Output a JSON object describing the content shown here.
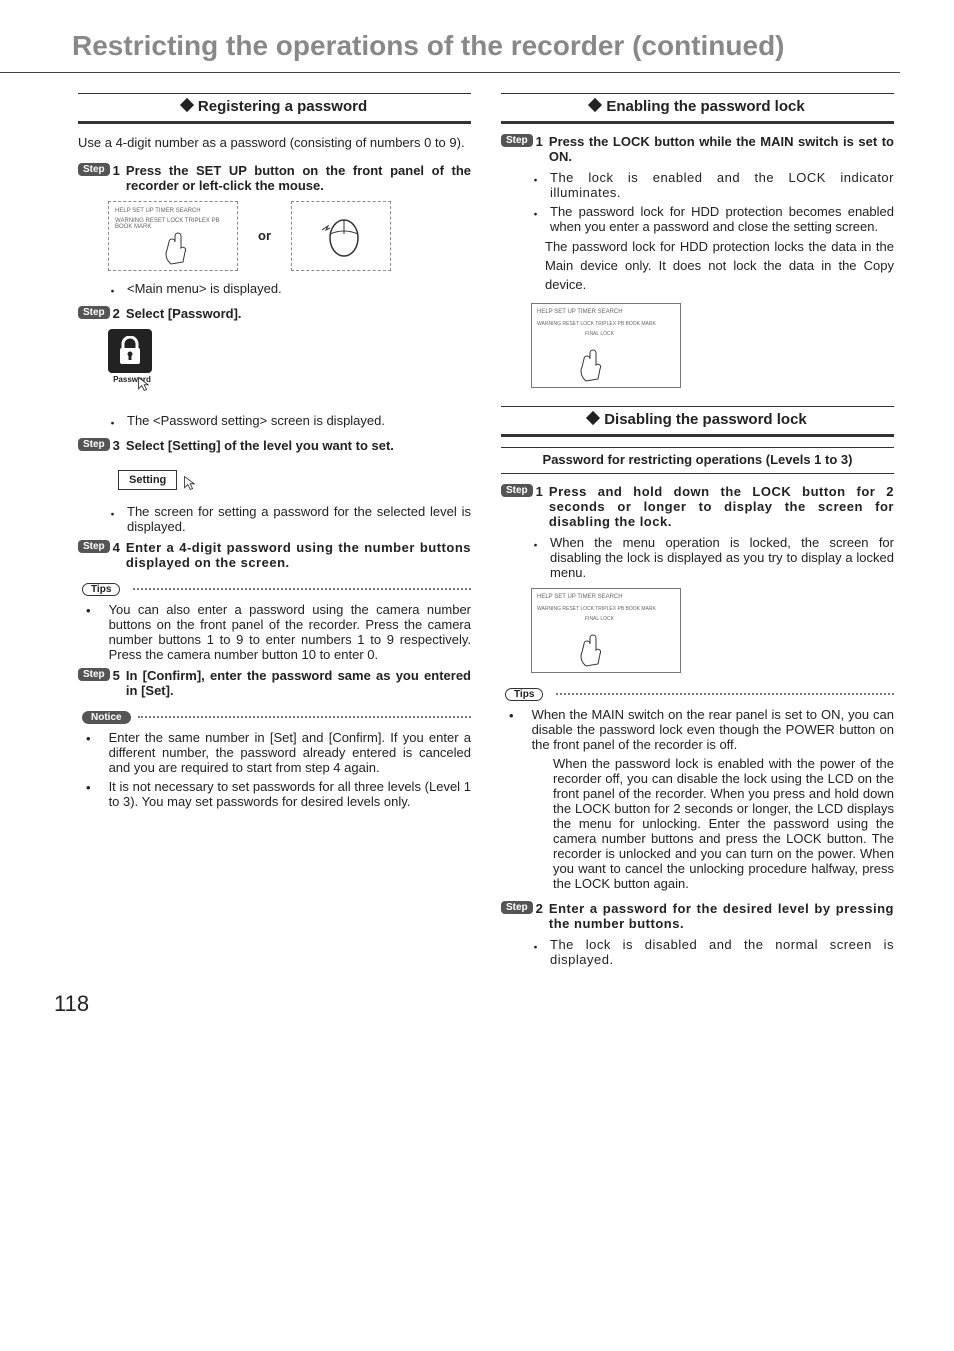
{
  "pageTitle": "Restricting the operations of the recorder (continued)",
  "pageNumber": "118",
  "labels": {
    "step": "Step",
    "tips": "Tips",
    "notice": "Notice",
    "or": "or"
  },
  "left": {
    "header": "Registering a password",
    "intro": "Use a 4-digit number as a password (consisting of numbers 0 to 9).",
    "step1": {
      "num": "1",
      "text": "Press the SET UP button on the front panel of the recorder or left-click the mouse."
    },
    "mainMenuNote": "<Main menu> is displayed.",
    "step2": {
      "num": "2",
      "text": "Select [Password]."
    },
    "passwordIconCaption": "Password",
    "pwSettingNote": "The <Password setting> screen is displayed.",
    "step3": {
      "num": "3",
      "text": "Select [Setting] of the level you want to set."
    },
    "settingBtn": "Setting",
    "levelNote": "The screen for setting a password for the selected level is displayed.",
    "step4": {
      "num": "4",
      "text": "Enter a 4-digit password using the number buttons displayed on the screen."
    },
    "tipsBody": "You can also enter a password using the camera number buttons on the front panel of the recorder. Press the camera number buttons 1 to 9 to enter numbers 1 to 9 respectively. Press the camera number button 10 to enter 0.",
    "step5": {
      "num": "5",
      "text": "In [Confirm], enter the password same as you entered in [Set]."
    },
    "notice1": "Enter the same number in [Set] and [Confirm]. If you enter a different number, the password already entered is canceled and you are required to start from step 4 again.",
    "notice2": "It is not necessary to set passwords for all three levels (Level 1 to 3). You may set passwords for desired levels only."
  },
  "right": {
    "enableHeader": "Enabling the password lock",
    "enableStep1": {
      "num": "1",
      "text": "Press the LOCK button while the MAIN switch is set to ON."
    },
    "enableNote1": "The lock is enabled and the LOCK indicator illuminates.",
    "enableNote2": "The password lock for HDD protection becomes enabled when you enter a password and close the setting screen.",
    "enableNote3": "The password lock for HDD protection locks the data in the Main device only. It does not lock the data in the Copy device.",
    "disableHeader": "Disabling the password lock",
    "subHeader": "Password for restricting operations (Levels 1 to 3)",
    "disableStep1": {
      "num": "1",
      "text": "Press and hold down the LOCK button for 2 seconds or longer to display the screen for disabling the lock."
    },
    "disableNote1": "When the menu operation is locked, the screen for disabling the lock is displayed as you try to display a locked menu.",
    "tips1": "When the MAIN switch on the rear panel is set to ON, you can disable the password lock even though the POWER button on the front panel of the recorder is off.",
    "tips2": "When the password lock is enabled with the power of the recorder off, you can disable the lock using the LCD on the front panel of the recorder. When you press and hold down the LOCK button for 2 seconds or longer, the LCD displays the menu for unlocking. Enter the password using the camera number buttons and press the LOCK button. The recorder is unlocked and you can turn on the power. When you want to cancel the unlocking procedure halfway, press the LOCK button again.",
    "disableStep2": {
      "num": "2",
      "text": "Enter a password for the desired level by pressing the number buttons."
    },
    "disableNote2": "The lock is disabled and the normal screen is displayed."
  },
  "panelLabels": {
    "top": "HELP  SET UP  TIMER  SEARCH",
    "mid": "WARNING RESET  LOCK  TRIPLEX PB  BOOK MARK",
    "f": "FINAL LOCK"
  }
}
